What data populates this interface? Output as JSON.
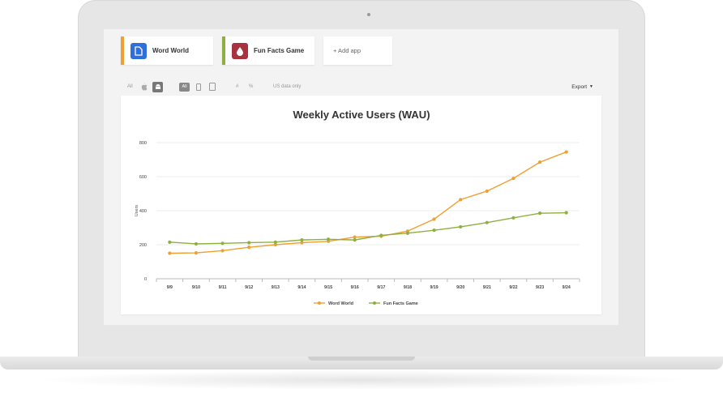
{
  "apps": [
    {
      "name": "Word World",
      "accent": "#f0a030",
      "icon": "document-icon",
      "icon_bg": "#2f6fdc"
    },
    {
      "name": "Fun Facts Game",
      "accent": "#8db040",
      "icon": "drop-icon",
      "icon_bg": "#a8323e"
    }
  ],
  "add_app_label": "+ Add app",
  "toolbar": {
    "platform_all": "All",
    "device_all": "All",
    "hash": "#",
    "percent": "%",
    "us_only": "US data only",
    "export": "Export"
  },
  "chart_data": {
    "type": "line",
    "title": "Weekly Active Users (WAU)",
    "xlabel": "",
    "ylabel": "Users",
    "categories": [
      "9/9",
      "9/10",
      "9/11",
      "9/12",
      "9/13",
      "9/14",
      "9/15",
      "9/16",
      "9/17",
      "9/18",
      "9/19",
      "9/20",
      "9/21",
      "9/22",
      "9/23",
      "9/24"
    ],
    "ylim": [
      0,
      800
    ],
    "yticks": [
      0,
      200,
      400,
      600,
      800
    ],
    "grid": true,
    "legend": "bottom",
    "series": [
      {
        "name": "Word World",
        "color": "#f0a030",
        "values": [
          150,
          152,
          165,
          185,
          200,
          212,
          220,
          245,
          250,
          280,
          350,
          465,
          515,
          590,
          685,
          745
        ]
      },
      {
        "name": "Fun Facts Game",
        "color": "#8db040",
        "values": [
          215,
          205,
          208,
          212,
          215,
          228,
          232,
          228,
          255,
          268,
          285,
          305,
          330,
          358,
          385,
          388
        ]
      }
    ]
  }
}
